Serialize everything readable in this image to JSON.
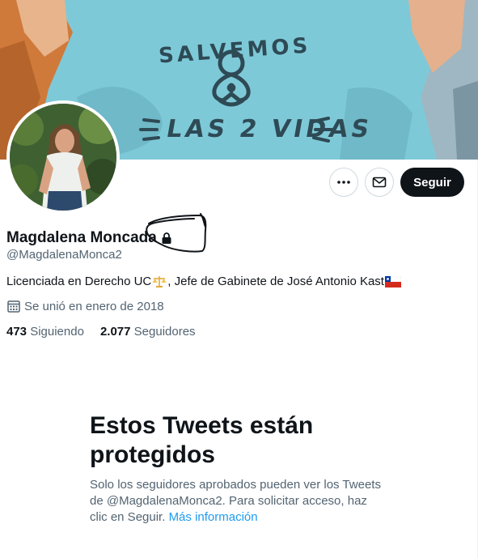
{
  "banner": {
    "text_top": "SALVEMOS",
    "text_bottom": "LAS 2 VIDAS"
  },
  "profile": {
    "name": "Magdalena Moncada",
    "handle": "@MagdalenaMonca2",
    "bio_part1": "Licenciada en Derecho UC",
    "bio_part2": ", Jefe de Gabinete de José Antonio Kast",
    "joined": "Se unió en enero de 2018"
  },
  "actions": {
    "follow_label": "Seguir"
  },
  "stats": {
    "following_count": "473",
    "following_label": "Siguiendo",
    "followers_count": "2.077",
    "followers_label": "Seguidores"
  },
  "protected": {
    "title": "Estos Tweets están protegidos",
    "description": "Solo los seguidores aprobados pueden ver los Tweets de @MagdalenaMonca2. Para solicitar acceso, haz clic en Seguir. ",
    "link": "Más información"
  },
  "colors": {
    "accent": "#1d9bf0",
    "text_primary": "#0f1419",
    "text_secondary": "#536471",
    "banner_bg": "#7ec9d8"
  }
}
